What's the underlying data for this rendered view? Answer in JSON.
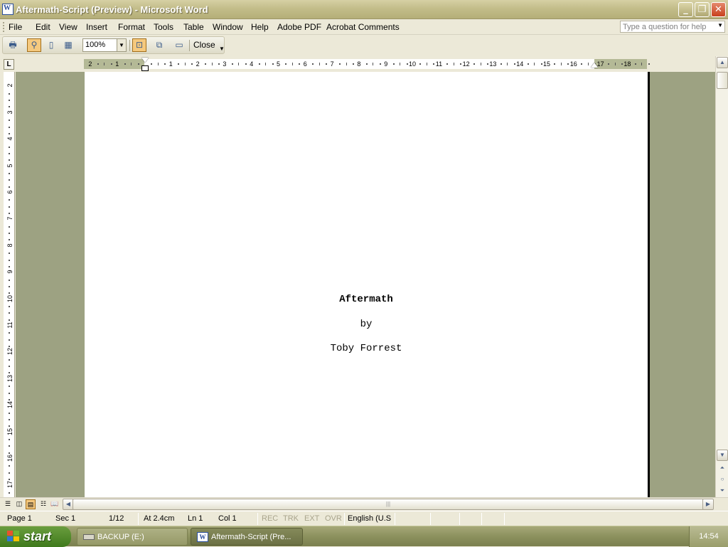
{
  "window": {
    "title": "Aftermath-Script (Preview) - Microsoft Word",
    "app_icon": "word-icon",
    "controls": [
      "minimize-icon",
      "restore-icon",
      "close-icon"
    ]
  },
  "menu": {
    "items": [
      "File",
      "Edit",
      "View",
      "Insert",
      "Format",
      "Tools",
      "Table",
      "Window",
      "Help",
      "Adobe PDF",
      "Acrobat Comments"
    ],
    "ask_placeholder": "Type a question for help"
  },
  "toolbar": {
    "zoom": "100%",
    "close_label": "Close",
    "buttons": [
      "print-icon",
      "magnifier-icon",
      "one-page-icon",
      "multiple-pages-icon",
      "view-ruler-icon",
      "shrink-to-fit-icon",
      "full-screen-icon"
    ]
  },
  "ruler": {
    "h_left_labels": [
      "2",
      "1"
    ],
    "h_labels": [
      "1",
      "2",
      "3",
      "4",
      "5",
      "6",
      "7",
      "8",
      "9",
      "10",
      "11",
      "12",
      "13",
      "14",
      "15",
      "16",
      "17",
      "18"
    ],
    "v_labels": [
      "2",
      "3",
      "4",
      "5",
      "6",
      "7",
      "8",
      "9",
      "10",
      "11",
      "12",
      "13",
      "14",
      "15",
      "16",
      "17"
    ],
    "tab_selector": "L"
  },
  "document": {
    "title": "Aftermath",
    "by": "by",
    "author": "Toby Forrest"
  },
  "status": {
    "page": "Page 1",
    "sec": "Sec 1",
    "pages": "1/12",
    "at": "At 2.4cm",
    "ln": "Ln 1",
    "col": "Col 1",
    "rec": "REC",
    "trk": "TRK",
    "ext": "EXT",
    "ovr": "OVR",
    "language": "English (U.S"
  },
  "taskbar": {
    "start": "start",
    "tasks": [
      "BACKUP (E:)",
      "Aftermath-Script (Pre..."
    ],
    "clock": "14:54"
  }
}
